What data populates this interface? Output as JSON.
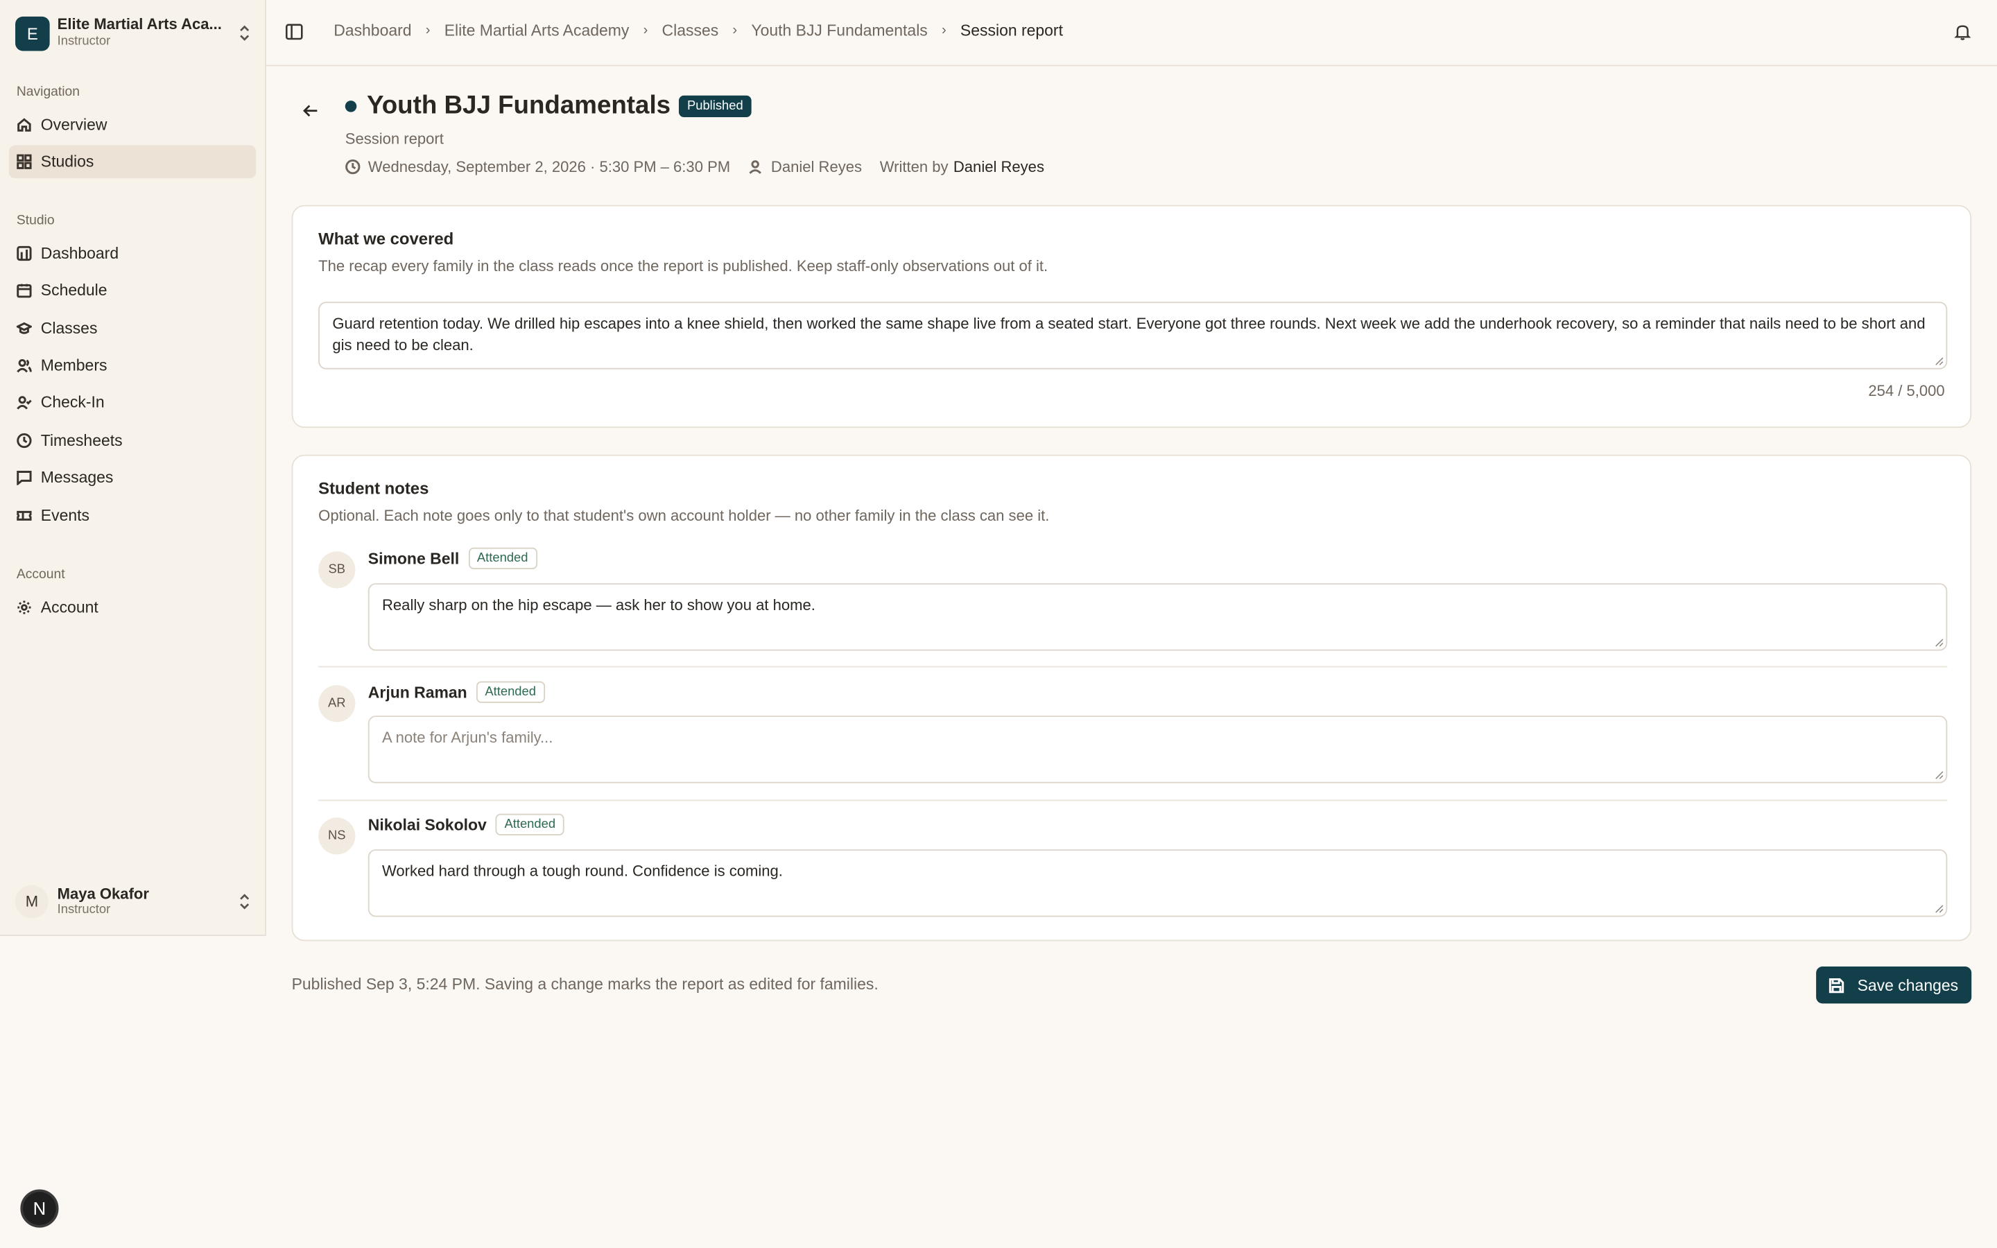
{
  "org": {
    "initial": "E",
    "name": "Elite Martial Arts Aca...",
    "role": "Instructor"
  },
  "nav_sections": {
    "navigation": "Navigation",
    "studio": "Studio",
    "account": "Account"
  },
  "nav": {
    "overview": "Overview",
    "studios": "Studios",
    "dashboard": "Dashboard",
    "schedule": "Schedule",
    "classes": "Classes",
    "members": "Members",
    "checkin": "Check-In",
    "timesheets": "Timesheets",
    "messages": "Messages",
    "events": "Events",
    "account": "Account"
  },
  "user": {
    "initial": "M",
    "name": "Maya Okafor",
    "role": "Instructor"
  },
  "breadcrumbs": [
    "Dashboard",
    "Elite Martial Arts Academy",
    "Classes",
    "Youth BJJ Fundamentals",
    "Session report"
  ],
  "header": {
    "title": "Youth BJJ Fundamentals",
    "status": "Published",
    "subtitle": "Session report",
    "datetime": "Wednesday, September 2, 2026 · 5:30 PM – 6:30 PM",
    "instructor": "Daniel Reyes",
    "written_by_label": "Written by",
    "written_by": "Daniel Reyes"
  },
  "covered": {
    "title": "What we covered",
    "description": "The recap every family in the class reads once the report is published. Keep staff-only observations out of it.",
    "text": "Guard retention today. We drilled hip escapes into a knee shield, then worked the same shape live from a seated start. Everyone got three rounds. Next week we add the underhook recovery, so a reminder that nails need to be short and gis need to be clean.",
    "count": "254 / 5,000"
  },
  "notes": {
    "title": "Student notes",
    "description": "Optional. Each note goes only to that student's own account holder — no other family in the class can see it.",
    "students": [
      {
        "initials": "SB",
        "name": "Simone Bell",
        "status": "Attended",
        "note": "Really sharp on the hip escape — ask her to show you at home.",
        "placeholder": ""
      },
      {
        "initials": "AR",
        "name": "Arjun Raman",
        "status": "Attended",
        "note": "",
        "placeholder": "A note for Arjun's family..."
      },
      {
        "initials": "NS",
        "name": "Nikolai Sokolov",
        "status": "Attended",
        "note": "Worked hard through a tough round. Confidence is coming.",
        "placeholder": ""
      }
    ]
  },
  "footer": {
    "status": "Published Sep 3, 5:24 PM. Saving a change marks the report as edited for families.",
    "save_label": "Save changes"
  },
  "dev_badge": "N",
  "colors": {
    "accent": "#123f4a",
    "background": "#fbf8f3",
    "sidebar": "#f7f2ea",
    "attended": "#2d6a4f"
  }
}
